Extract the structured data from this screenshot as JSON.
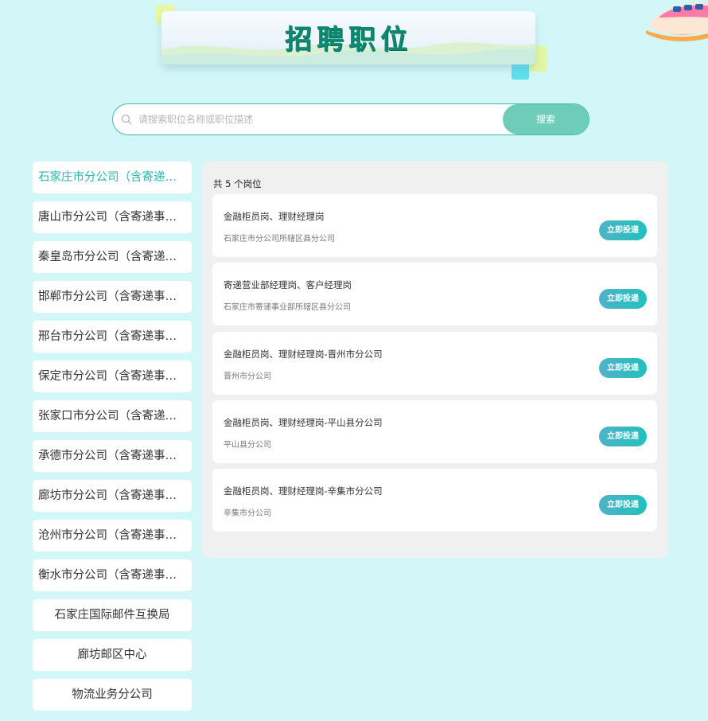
{
  "header": {
    "title": "招聘职位"
  },
  "search": {
    "placeholder": "请搜索职位名称或职位描述",
    "value": "",
    "button_label": "搜索"
  },
  "sidebar": {
    "items": [
      {
        "label": "石家庄市分公司（含寄递事业部）",
        "active": true
      },
      {
        "label": "唐山市分公司（含寄递事业部）"
      },
      {
        "label": "秦皇岛市分公司（含寄递事业部）"
      },
      {
        "label": "邯郸市分公司（含寄递事业部）"
      },
      {
        "label": "邢台市分公司（含寄递事业部）"
      },
      {
        "label": "保定市分公司（含寄递事业部）"
      },
      {
        "label": "张家口市分公司（含寄递事业部）"
      },
      {
        "label": "承德市分公司（含寄递事业部）"
      },
      {
        "label": "廊坊市分公司（含寄递事业部）"
      },
      {
        "label": "沧州市分公司（含寄递事业部）"
      },
      {
        "label": "衡水市分公司（含寄递事业部）"
      },
      {
        "label": "石家庄国际邮件互换局"
      },
      {
        "label": "廊坊邮区中心"
      },
      {
        "label": "物流业务分公司"
      }
    ]
  },
  "jobs": {
    "count_label": "共 5 个岗位",
    "apply_label": "立即投递",
    "items": [
      {
        "title": "金融柜员岗、理财经理岗",
        "org": "石家庄市分公司所辖区县分公司"
      },
      {
        "title": "寄递营业部经理岗、客户经理岗",
        "org": "石家庄市寄递事业部所辖区县分公司"
      },
      {
        "title": "金融柜员岗、理财经理岗-晋州市分公司",
        "org": "晋州市分公司"
      },
      {
        "title": "金融柜员岗、理财经理岗-平山县分公司",
        "org": "平山县分公司"
      },
      {
        "title": "金融柜员岗、理财经理岗-辛集市分公司",
        "org": "辛集市分公司"
      }
    ]
  },
  "colors": {
    "background": "#d3f7f8",
    "accent": "#2cb6b0",
    "search_button": "#6ecdb8",
    "title": "#0f8a72"
  },
  "icons": {
    "search": "search-icon",
    "train": "train-illustration"
  }
}
